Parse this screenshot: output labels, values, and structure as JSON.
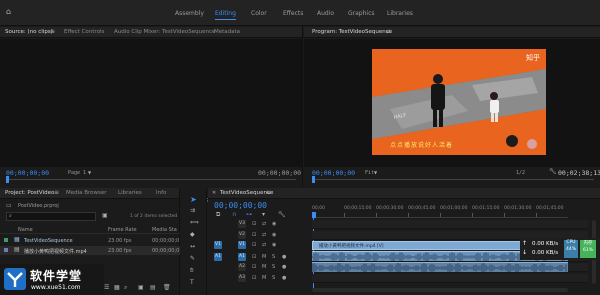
{
  "workspaces": {
    "items": [
      "Assembly",
      "Editing",
      "Color",
      "Effects",
      "Audio",
      "Graphics",
      "Libraries"
    ],
    "active": "Editing"
  },
  "source_panel": {
    "tabs": [
      "Source: (no clips)",
      "Effect Controls",
      "Audio Clip Mixer: TestVideoSequence",
      "Metadata"
    ],
    "timecode_left": "00;00;00;00",
    "page": "Page 1",
    "timecode_right": "00;00;00;00"
  },
  "program_panel": {
    "tab": "Program: TestVideoSequence",
    "timecode_left": "00;00;00;00",
    "fit": "Fit",
    "quality": "1/2",
    "timecode_right": "00;02;38;13",
    "video": {
      "watermark": "知乎",
      "subtitle": "点点播放说好人活着"
    }
  },
  "project_panel": {
    "tabs": [
      "Project: PostVideo",
      "Media Browser",
      "Libraries",
      "Info"
    ],
    "project_file": "PostVideo.prproj",
    "search_placeholder": "",
    "item_count": "1 of 2 items selected",
    "columns": [
      "Name",
      "Frame Rate",
      "Media Sta"
    ],
    "rows": [
      {
        "name": "TestVideoSequence",
        "frame_rate": "23.00 fps",
        "media_start": "00;00;00;0"
      },
      {
        "name": "播放小黄鸭把视频文件.mp4",
        "frame_rate": "23.00 fps",
        "media_start": "00;00;00;0"
      }
    ]
  },
  "timeline_panel": {
    "tab": "TestVideoSequence",
    "timecode": "00;00;00;00",
    "ruler_labels": [
      "00;00",
      "00;00;15;00",
      "00;00;30;00",
      "00;00;45;00",
      "00;01;00;00",
      "00;01;15;00",
      "00;01;30;00",
      "00;01;45;00"
    ],
    "tracks": [
      {
        "id": "V3",
        "type": "video"
      },
      {
        "id": "V2",
        "type": "video"
      },
      {
        "id": "V1",
        "type": "video"
      },
      {
        "id": "A1",
        "type": "audio"
      },
      {
        "id": "A2",
        "type": "audio"
      },
      {
        "id": "A3",
        "type": "audio"
      }
    ],
    "clip_label": "播放小黄鸭把视频文件.mp4 [V]",
    "source_patch_v": "V1",
    "source_patch_a": "A1"
  },
  "network_widget": {
    "up_rate": "0.00 KB/s",
    "down_rate": "0.00 KB/s",
    "cpu_label": "CPU",
    "cpu_value": "44%",
    "mem_label": "内存",
    "mem_value": "61%"
  },
  "watermark_logo": {
    "text_cn": "软件学堂",
    "text_url": "www.xue51.com"
  },
  "colors": {
    "accent": "#3b8df2",
    "clip": "#7fa8d2",
    "panel_bg": "#1b1b1b",
    "tab_bg": "#232323",
    "video_floor": "#e8641f",
    "cpu_green": "#45b35a"
  }
}
